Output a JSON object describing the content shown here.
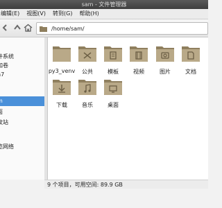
{
  "window": {
    "title": "sam - 文件管理器"
  },
  "menubar": {
    "items": [
      "编辑(E)",
      "视图(V)",
      "转到(G)",
      "帮助(H)"
    ]
  },
  "toolbar": {
    "path": "/home/sam/"
  },
  "sidebar": {
    "items": [
      {
        "label": "件系统",
        "selected": false
      },
      {
        "label": "加卷",
        "selected": false
      },
      {
        "label": "n7",
        "selected": false
      },
      {
        "label": "m",
        "selected": true
      },
      {
        "label": "面",
        "selected": false
      },
      {
        "label": "纹站",
        "selected": false
      },
      {
        "label": "览网络",
        "selected": false
      }
    ]
  },
  "files": [
    {
      "name": "py3_venv",
      "icon": "folder-icon"
    },
    {
      "name": "公共",
      "icon": "folder-public-icon"
    },
    {
      "name": "模板",
      "icon": "folder-templates-icon"
    },
    {
      "name": "视频",
      "icon": "folder-videos-icon"
    },
    {
      "name": "图片",
      "icon": "folder-pictures-icon"
    },
    {
      "name": "文档",
      "icon": "folder-documents-icon"
    },
    {
      "name": "下载",
      "icon": "folder-download-icon"
    },
    {
      "name": "音乐",
      "icon": "folder-music-icon"
    },
    {
      "name": "桌面",
      "icon": "folder-desktop-icon"
    }
  ],
  "status": {
    "text": "9 个项目，可用空间: 89.9 GB"
  },
  "colors": {
    "selection": "#4a90d9",
    "folder": "#b9a988",
    "folder_dark": "#8f7f5e"
  }
}
